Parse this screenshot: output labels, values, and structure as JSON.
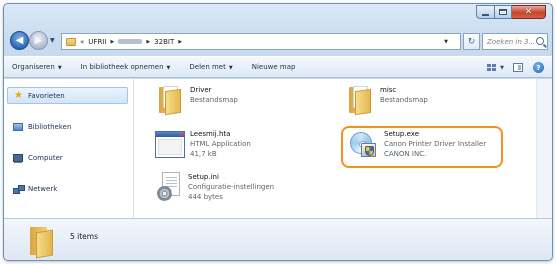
{
  "address_bar": {
    "overflow": "«",
    "crumbs": [
      "UFRII",
      "32BIT"
    ],
    "search_placeholder": "Zoeken in 3..."
  },
  "toolbar": {
    "organize": "Organiseren",
    "include_in_library": "In bibliotheek opnemen",
    "share_with": "Delen met",
    "new_folder": "Nieuwe map"
  },
  "navigation": {
    "favorites": "Favorieten",
    "libraries": "Bibliotheken",
    "computer": "Computer",
    "network": "Netwerk"
  },
  "files": [
    {
      "name": "Driver",
      "type": "Bestandsmap",
      "detail": ""
    },
    {
      "name": "misc",
      "type": "Bestandsmap",
      "detail": ""
    },
    {
      "name": "Leesmij.hta",
      "type": "HTML Application",
      "detail": "41,7 kB"
    },
    {
      "name": "Setup.exe",
      "type": "Canon Printer Driver Installer",
      "detail": "CANON INC."
    },
    {
      "name": "Setup.ini",
      "type": "Configuratie-instellingen",
      "detail": "444 bytes"
    }
  ],
  "details": {
    "item_count": "5 items"
  },
  "colors": {
    "highlight": "#f0921f",
    "window_frame": "#c7daf0",
    "selected_nav": "#d2e5fa"
  }
}
